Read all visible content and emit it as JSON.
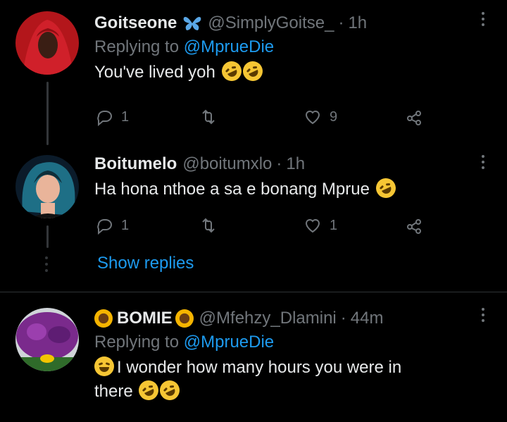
{
  "tweets": [
    {
      "name": "Goitseone",
      "name_suffix_icon": "butterfly-icon",
      "handle": "@SimplyGoitse_",
      "dot": "·",
      "time": "1h",
      "replying_prefix": "Replying to",
      "replying_to": "@MprueDie",
      "text": "You've lived yoh",
      "emojis": [
        "rolling-on-floor-laughing-icon",
        "rolling-on-floor-laughing-icon"
      ],
      "reply_count": "1",
      "retweet_count": "",
      "like_count": "9"
    },
    {
      "name": "Boitumelo",
      "handle": "@boitumxlo",
      "dot": "·",
      "time": "1h",
      "text": "Ha hona nthoe a sa e bonang Mprue",
      "emojis": [
        "rolling-on-floor-laughing-icon"
      ],
      "reply_count": "1",
      "retweet_count": "",
      "like_count": "1"
    },
    {
      "name": "BOMIE",
      "name_prefix_icon": "sunflower-icon",
      "name_suffix_icon": "sunflower-icon",
      "handle": "@Mfehzy_Dlamini",
      "dot": "·",
      "time": "44m",
      "replying_prefix": "Replying to",
      "replying_to": "@MprueDie",
      "text_line1": "I wonder how many hours you were in",
      "text_line2": "there",
      "lead_emoji": "face-with-tears-of-joy-icon",
      "emojis": [
        "rolling-on-floor-laughing-icon",
        "rolling-on-floor-laughing-icon"
      ]
    }
  ],
  "show_replies": "Show replies",
  "colors": {
    "background": "#000000",
    "primary_text": "#e7e9ea",
    "secondary_text": "#71767b",
    "accent": "#1d9bf0"
  }
}
